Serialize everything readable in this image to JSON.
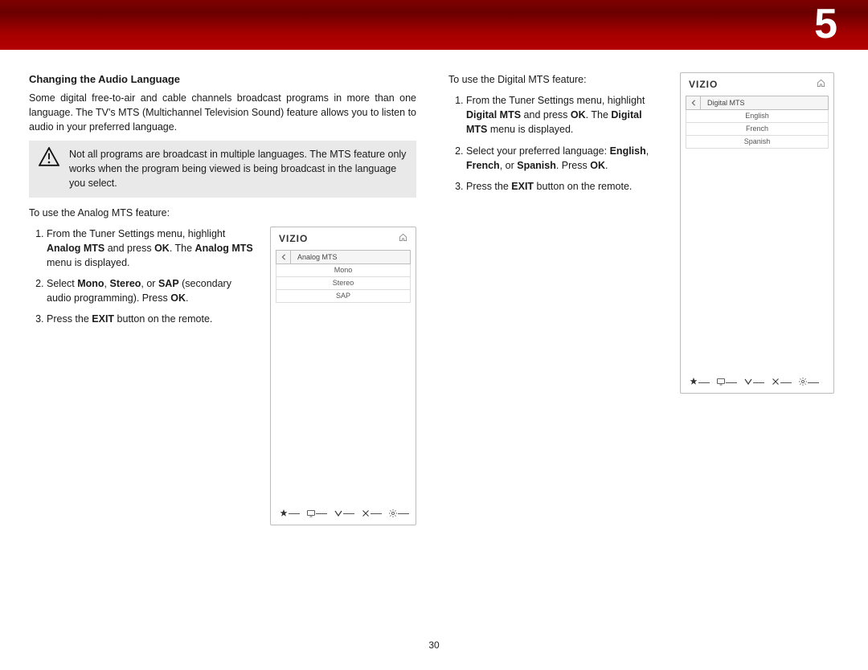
{
  "page": {
    "chapter_number": "5",
    "page_number": "30"
  },
  "left": {
    "heading": "Changing the Audio Language",
    "intro": "Some digital free-to-air and cable channels broadcast programs in more than one language. The TV's MTS (Multichannel Television Sound) feature allows you to listen to audio in your preferred language.",
    "note": "Not all programs are broadcast in multiple languages. The MTS feature only works when the program being viewed is being broadcast in the language you select.",
    "analog_lead": "To use the Analog MTS feature:",
    "analog_steps": {
      "s1_a": "From the Tuner Settings menu, highlight ",
      "s1_b": "Analog MTS",
      "s1_c": " and press ",
      "s1_d": "OK",
      "s1_e": ". The ",
      "s1_f": "Analog MTS",
      "s1_g": " menu is displayed.",
      "s2_a": "Select ",
      "s2_b": "Mono",
      "s2_c": ", ",
      "s2_d": "Stereo",
      "s2_e": ", or ",
      "s2_f": "SAP",
      "s2_g": " (secondary audio programming). Press ",
      "s2_h": "OK",
      "s2_i": ".",
      "s3_a": "Press the ",
      "s3_b": "EXIT",
      "s3_c": " button on the remote."
    }
  },
  "right": {
    "digital_lead": "To use the Digital MTS feature:",
    "digital_steps": {
      "s1_a": "From the Tuner Settings menu, highlight ",
      "s1_b": "Digital MTS",
      "s1_c": " and press ",
      "s1_d": "OK",
      "s1_e": ". The ",
      "s1_f": "Digital MTS",
      "s1_g": " menu is displayed.",
      "s2_a": "Select your preferred language: ",
      "s2_b": "English",
      "s2_c": ", ",
      "s2_d": "French",
      "s2_e": ", or ",
      "s2_f": "Spanish",
      "s2_g": ". Press ",
      "s2_h": "OK",
      "s2_i": ".",
      "s3_a": "Press the ",
      "s3_b": "EXIT",
      "s3_c": " button on the remote."
    }
  },
  "tv_analog": {
    "logo": "VIZIO",
    "title": "Analog MTS",
    "items": [
      "Mono",
      "Stereo",
      "SAP"
    ]
  },
  "tv_digital": {
    "logo": "VIZIO",
    "title": "Digital MTS",
    "items": [
      "English",
      "French",
      "Spanish"
    ]
  }
}
